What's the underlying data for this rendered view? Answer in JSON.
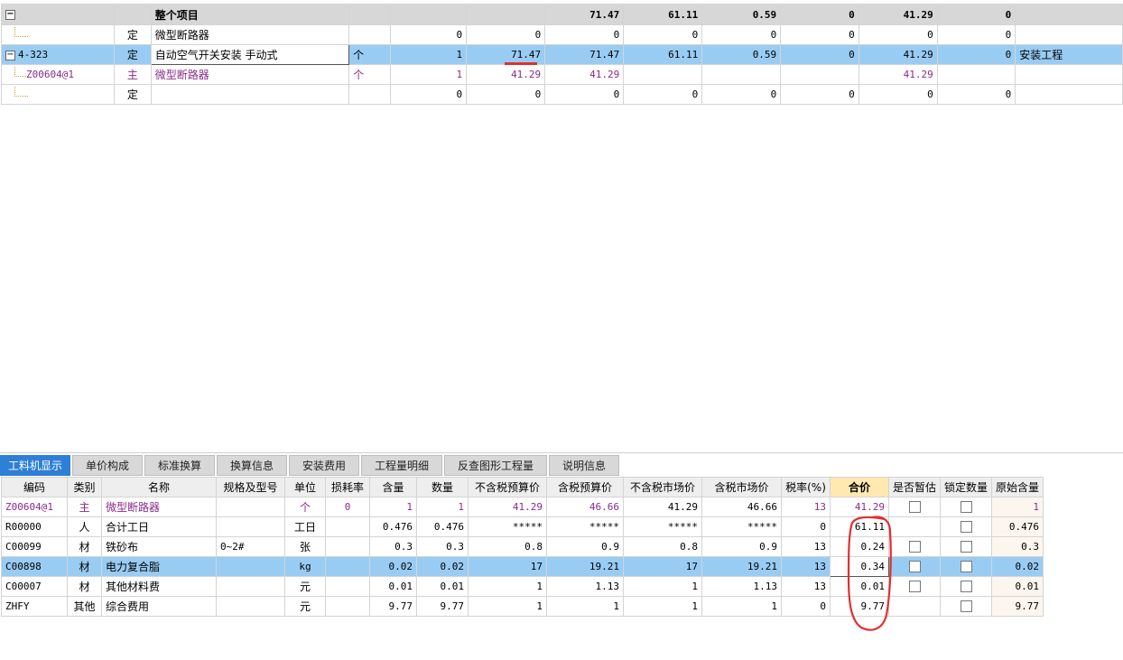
{
  "top_grid": {
    "total_row": {
      "toggle": "−",
      "name": "整个项目",
      "v1": "71.47",
      "v2": "61.11",
      "v3": "0.59",
      "v4": "0",
      "v5": "41.29",
      "v6": "0"
    },
    "rows": [
      {
        "code": "",
        "type": "定",
        "name": "微型断路器",
        "unit": "",
        "qty": "0",
        "price": "0",
        "total": "0",
        "c1": "0",
        "c2": "0",
        "c3": "0",
        "c4": "0",
        "c5": "0",
        "note": ""
      },
      {
        "code": "4-323",
        "type": "定",
        "name": "自动空气开关安装 手动式",
        "unit": "个",
        "qty": "1",
        "price": "71.47",
        "total": "71.47",
        "c1": "61.11",
        "c2": "0.59",
        "c3": "0",
        "c4": "41.29",
        "c5": "0",
        "note": "安装工程"
      },
      {
        "code": "Z00604@1",
        "type": "主",
        "name": "微型断路器",
        "unit": "个",
        "qty": "1",
        "price": "41.29",
        "total": "41.29",
        "c1": "",
        "c2": "",
        "c3": "",
        "c4": "41.29",
        "c5": "",
        "note": ""
      },
      {
        "code": "",
        "type": "定",
        "name": "",
        "unit": "",
        "qty": "0",
        "price": "0",
        "total": "0",
        "c1": "0",
        "c2": "0",
        "c3": "0",
        "c4": "0",
        "c5": "0",
        "note": ""
      }
    ]
  },
  "tabs": [
    "工料机显示",
    "单价构成",
    "标准换算",
    "换算信息",
    "安装费用",
    "工程量明细",
    "反查图形工程量",
    "说明信息"
  ],
  "bottom_grid": {
    "headers": [
      "编码",
      "类别",
      "名称",
      "规格及型号",
      "单位",
      "损耗率",
      "含量",
      "数量",
      "不含税预算价",
      "含税预算价",
      "不含税市场价",
      "含税市场价",
      "税率(%)",
      "合价",
      "是否暂估",
      "锁定数量",
      "原始含量"
    ],
    "rows": [
      {
        "code": "Z00604@1",
        "cat": "主",
        "name": "微型断路器",
        "spec": "",
        "unit": "个",
        "loss": "0",
        "content": "1",
        "qty": "1",
        "p1": "41.29",
        "p2": "46.66",
        "p3": "41.29",
        "p4": "46.66",
        "tax": "13",
        "sum": "41.29",
        "est": true,
        "lock": true,
        "orig": "1"
      },
      {
        "code": "R00000",
        "cat": "人",
        "name": "合计工日",
        "spec": "",
        "unit": "工日",
        "loss": "",
        "content": "0.476",
        "qty": "0.476",
        "p1": "*****",
        "p2": "*****",
        "p3": "*****",
        "p4": "*****",
        "tax": "0",
        "sum": "61.11",
        "est": false,
        "lock": true,
        "orig": "0.476"
      },
      {
        "code": "C00099",
        "cat": "材",
        "name": "铁砂布",
        "spec": "0~2#",
        "unit": "张",
        "loss": "",
        "content": "0.3",
        "qty": "0.3",
        "p1": "0.8",
        "p2": "0.9",
        "p3": "0.8",
        "p4": "0.9",
        "tax": "13",
        "sum": "0.24",
        "est": true,
        "lock": true,
        "orig": "0.3"
      },
      {
        "code": "C00898",
        "cat": "材",
        "name": "电力复合脂",
        "spec": "",
        "unit": "kg",
        "loss": "",
        "content": "0.02",
        "qty": "0.02",
        "p1": "17",
        "p2": "19.21",
        "p3": "17",
        "p4": "19.21",
        "tax": "13",
        "sum": "0.34",
        "est": true,
        "lock": true,
        "orig": "0.02"
      },
      {
        "code": "C00007",
        "cat": "材",
        "name": "其他材料费",
        "spec": "",
        "unit": "元",
        "loss": "",
        "content": "0.01",
        "qty": "0.01",
        "p1": "1",
        "p2": "1.13",
        "p3": "1",
        "p4": "1.13",
        "tax": "13",
        "sum": "0.01",
        "est": true,
        "lock": true,
        "orig": "0.01"
      },
      {
        "code": "ZHFY",
        "cat": "其他",
        "name": "综合费用",
        "spec": "",
        "unit": "元",
        "loss": "",
        "content": "9.77",
        "qty": "9.77",
        "p1": "1",
        "p2": "1",
        "p3": "1",
        "p4": "1",
        "tax": "0",
        "sum": "9.77",
        "est": false,
        "lock": true,
        "orig": "9.77"
      }
    ]
  },
  "colors": {
    "selected_row": "#99ccf3",
    "active_tab": "#2e7fd6",
    "annotation": "#e03030",
    "material_text": "#8a2b8a"
  }
}
